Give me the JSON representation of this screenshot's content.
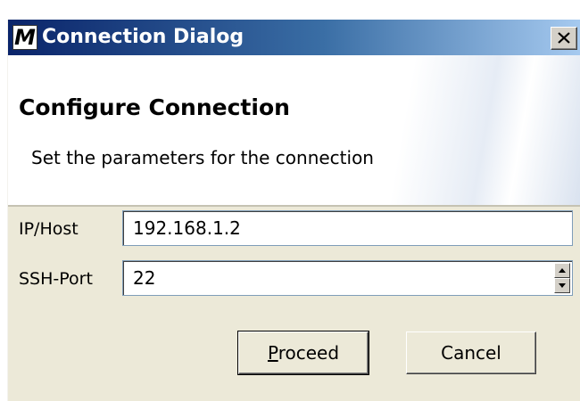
{
  "window": {
    "icon_letter": "M",
    "title": "Connection Dialog",
    "close_glyph": "close-icon"
  },
  "banner": {
    "title": "Configure Connection",
    "subtitle": "Set the parameters for the connection"
  },
  "form": {
    "host_label": "IP/Host",
    "host_value": "192.168.1.2",
    "port_label": "SSH-Port",
    "port_value": "22"
  },
  "buttons": {
    "proceed_mnemonic": "P",
    "proceed_rest": "roceed",
    "cancel": "Cancel"
  },
  "colors": {
    "titlebar_start": "#0a246a",
    "titlebar_end": "#a6caf0",
    "dialog_bg": "#ece9d8"
  }
}
